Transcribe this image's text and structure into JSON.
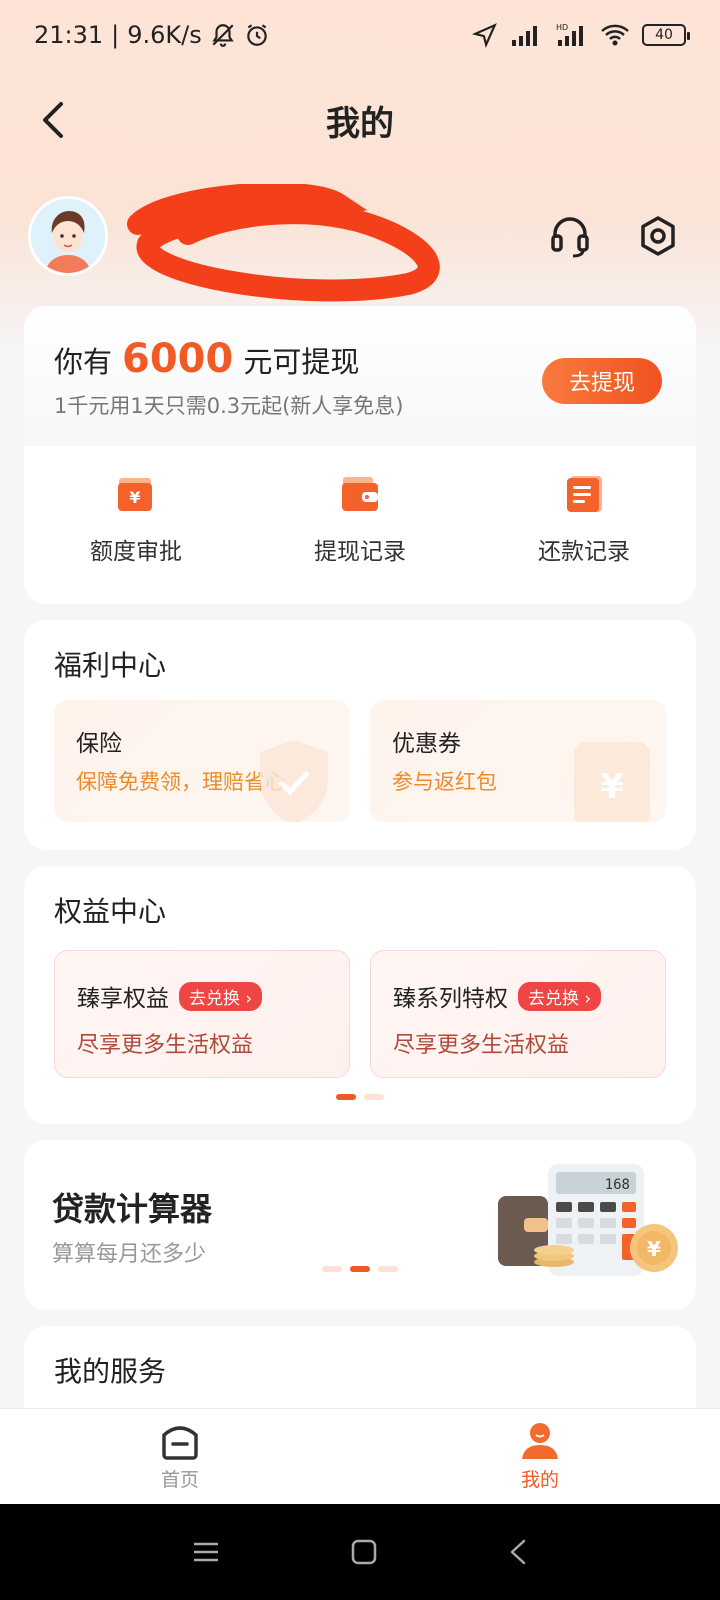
{
  "status_bar": {
    "time": "21:31",
    "speed": "9.6K/s",
    "battery": "40",
    "hd": "HD"
  },
  "header": {
    "title": "我的"
  },
  "cash": {
    "prefix": "你有",
    "amount": "6000",
    "suffix": "元可提现",
    "subtitle": "1千元用1天只需0.3元起(新人享免息)",
    "button": "去提现"
  },
  "quick_actions": [
    {
      "label": "额度审批",
      "icon": "wallet-yen-icon"
    },
    {
      "label": "提现记录",
      "icon": "wallet-icon"
    },
    {
      "label": "还款记录",
      "icon": "document-icon"
    }
  ],
  "welfare": {
    "title": "福利中心",
    "items": [
      {
        "title": "保险",
        "subtitle": "保障免费领，理赔省心"
      },
      {
        "title": "优惠券",
        "subtitle": "参与返红包"
      }
    ]
  },
  "rights": {
    "title": "权益中心",
    "items": [
      {
        "title": "臻享权益",
        "badge": "去兑换 ›",
        "subtitle": "尽享更多生活权益"
      },
      {
        "title": "臻系列特权",
        "badge": "去兑换 ›",
        "subtitle": "尽享更多生活权益"
      }
    ]
  },
  "calculator": {
    "title": "贷款计算器",
    "subtitle": "算算每月还多少",
    "display": "168"
  },
  "services": {
    "title": "我的服务"
  },
  "bottom_nav": [
    {
      "label": "首页",
      "active": false
    },
    {
      "label": "我的",
      "active": true
    }
  ],
  "colors": {
    "accent": "#f15a25",
    "welfare_text": "#ee8a2a",
    "badge": "#ef4544"
  }
}
